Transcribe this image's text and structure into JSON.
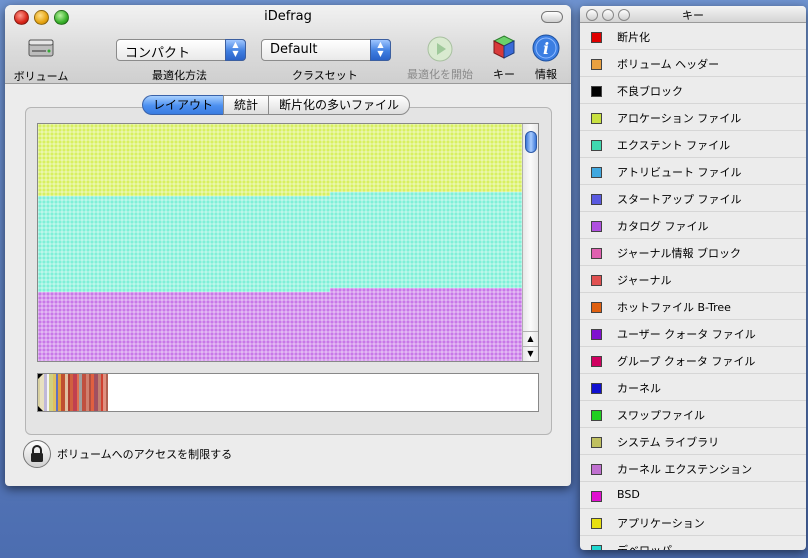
{
  "main_window": {
    "title": "iDefrag",
    "toolbar": {
      "volume_label": "ボリューム",
      "optimize_method_label": "最適化方法",
      "optimize_method_value": "コンパクト",
      "class_set_label": "クラスセット",
      "class_set_value": "Default",
      "start_label": "最適化を開始",
      "key_label": "キー",
      "info_label": "情報"
    },
    "tabs": [
      {
        "label": "レイアウト",
        "active": true
      },
      {
        "label": "統計",
        "active": false
      },
      {
        "label": "断片化の多いファイル",
        "active": false
      }
    ],
    "lock_label": "ボリュームへのアクセスを制限する"
  },
  "key_window": {
    "title": "キー",
    "items": [
      {
        "label": "断片化",
        "color": "#e00000"
      },
      {
        "label": "ボリューム ヘッダー",
        "color": "#e8a040"
      },
      {
        "label": "不良ブロック",
        "color": "#000000"
      },
      {
        "label": "アロケーション ファイル",
        "color": "#c8e040"
      },
      {
        "label": "エクステント ファイル",
        "color": "#40d8b0"
      },
      {
        "label": "アトリビュート ファイル",
        "color": "#40a8e0"
      },
      {
        "label": "スタートアップ ファイル",
        "color": "#5a5ae0"
      },
      {
        "label": "カタログ ファイル",
        "color": "#b050e0"
      },
      {
        "label": "ジャーナル情報 ブロック",
        "color": "#e060b0"
      },
      {
        "label": "ジャーナル",
        "color": "#e05050"
      },
      {
        "label": "ホットファイル B-Tree",
        "color": "#e06010"
      },
      {
        "label": "ユーザー クォータ ファイル",
        "color": "#8010d0"
      },
      {
        "label": "グループ クォータ ファイル",
        "color": "#d00060"
      },
      {
        "label": "カーネル",
        "color": "#1010d0"
      },
      {
        "label": "スワップファイル",
        "color": "#20d020"
      },
      {
        "label": "システム ライブラリ",
        "color": "#c0c060"
      },
      {
        "label": "カーネル エクステンション",
        "color": "#c070d0"
      },
      {
        "label": "BSD",
        "color": "#e010d0"
      },
      {
        "label": "アプリケーション",
        "color": "#e8e010"
      },
      {
        "label": "デベロッパ",
        "color": "#20d8d0"
      }
    ]
  }
}
